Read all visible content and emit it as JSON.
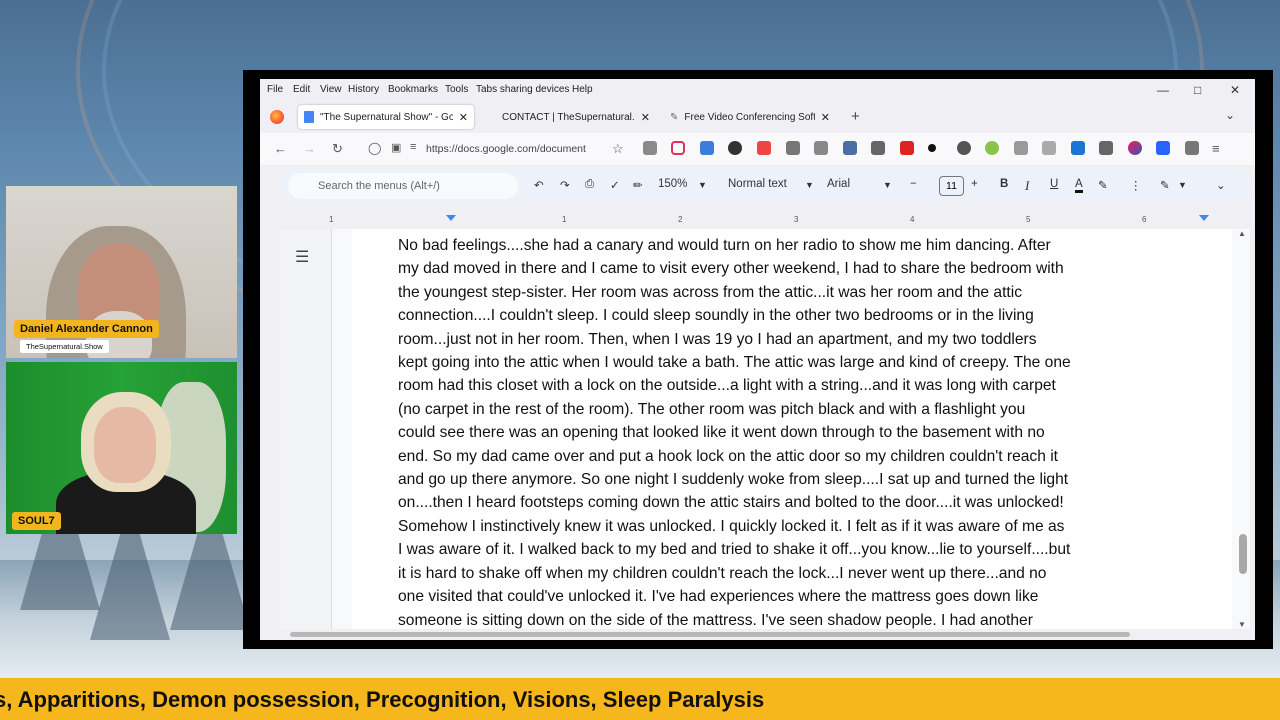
{
  "menu": {
    "items": [
      "File",
      "Edit",
      "View",
      "History",
      "Bookmarks",
      "Tools",
      "Tabs sharing devices",
      "Help"
    ]
  },
  "tabs": [
    {
      "label": "\"The Supernatural Show\" - Goo",
      "favicon": "docs-icon"
    },
    {
      "label": "CONTACT | TheSupernatural.Sh",
      "favicon": "page-icon"
    },
    {
      "label": "Free Video Conferencing Softw",
      "favicon": "pen-icon"
    }
  ],
  "address_bar": {
    "url": "https://docs.google.com/document"
  },
  "docs_toolbar": {
    "search_placeholder": "Search the menus (Alt+/)",
    "zoom": "150%",
    "style": "Normal text",
    "font": "Arial",
    "font_size": "11"
  },
  "ruler_ticks": [
    "1",
    "1",
    "2",
    "3",
    "4",
    "5",
    "6"
  ],
  "document": {
    "lines": [
      "No bad feelings....she had a canary and would turn on her radio to show me him dancing. After",
      "my dad moved in there and I came to visit every other weekend, I had to share the bedroom with",
      "the youngest step-sister. Her room was across from the attic...it was her room and the attic",
      "connection....I couldn't sleep. I could sleep soundly in the other two bedrooms or in the living",
      "room...just not in her room. Then, when I was 19 yo I had an apartment, and my two toddlers",
      "kept going into the attic when I would take a bath. The attic was large and kind of creepy. The one",
      "room had this closet with a lock on the outside...a light with a string...and it was long with carpet",
      "(no carpet in the rest of the room). The other room was pitch black and with a flashlight you",
      "could see there was an opening that looked like it went down through to the basement with no",
      "end. So my dad came over and put a hook lock on the attic door so my children couldn't reach it",
      "and go up there anymore. So one night I suddenly woke from sleep....I sat up and turned the light",
      "on....then I heard footsteps coming down the attic stairs and bolted to the door....it was unlocked!",
      "Somehow I instinctively knew it was unlocked. I quickly locked it. I felt as if it was aware of me as",
      "I was aware of it. I walked back to my bed and tried to shake it off...you know...lie to yourself....but",
      "it is hard to shake off when my children couldn't reach the lock...I never went up there...and no",
      "one visited that could've unlocked it. I've had experiences where the mattress goes down like",
      "someone is sitting down on the side of the mattress. I've seen shadow people. I had another"
    ]
  },
  "cameras": [
    {
      "name": "Daniel Alexander Cannon",
      "subtitle": "TheSupernatural.Show"
    },
    {
      "name": "SOUL7"
    }
  ],
  "ticker": {
    "text": "s, Apparitions, Demon possession, Precognition, Visions, Sleep Paralysis"
  },
  "colors": {
    "ticker_bg": "#f5b71c",
    "docs_toolbar_bg": "#edf2fa",
    "badge_bg": "#f2b51e"
  }
}
